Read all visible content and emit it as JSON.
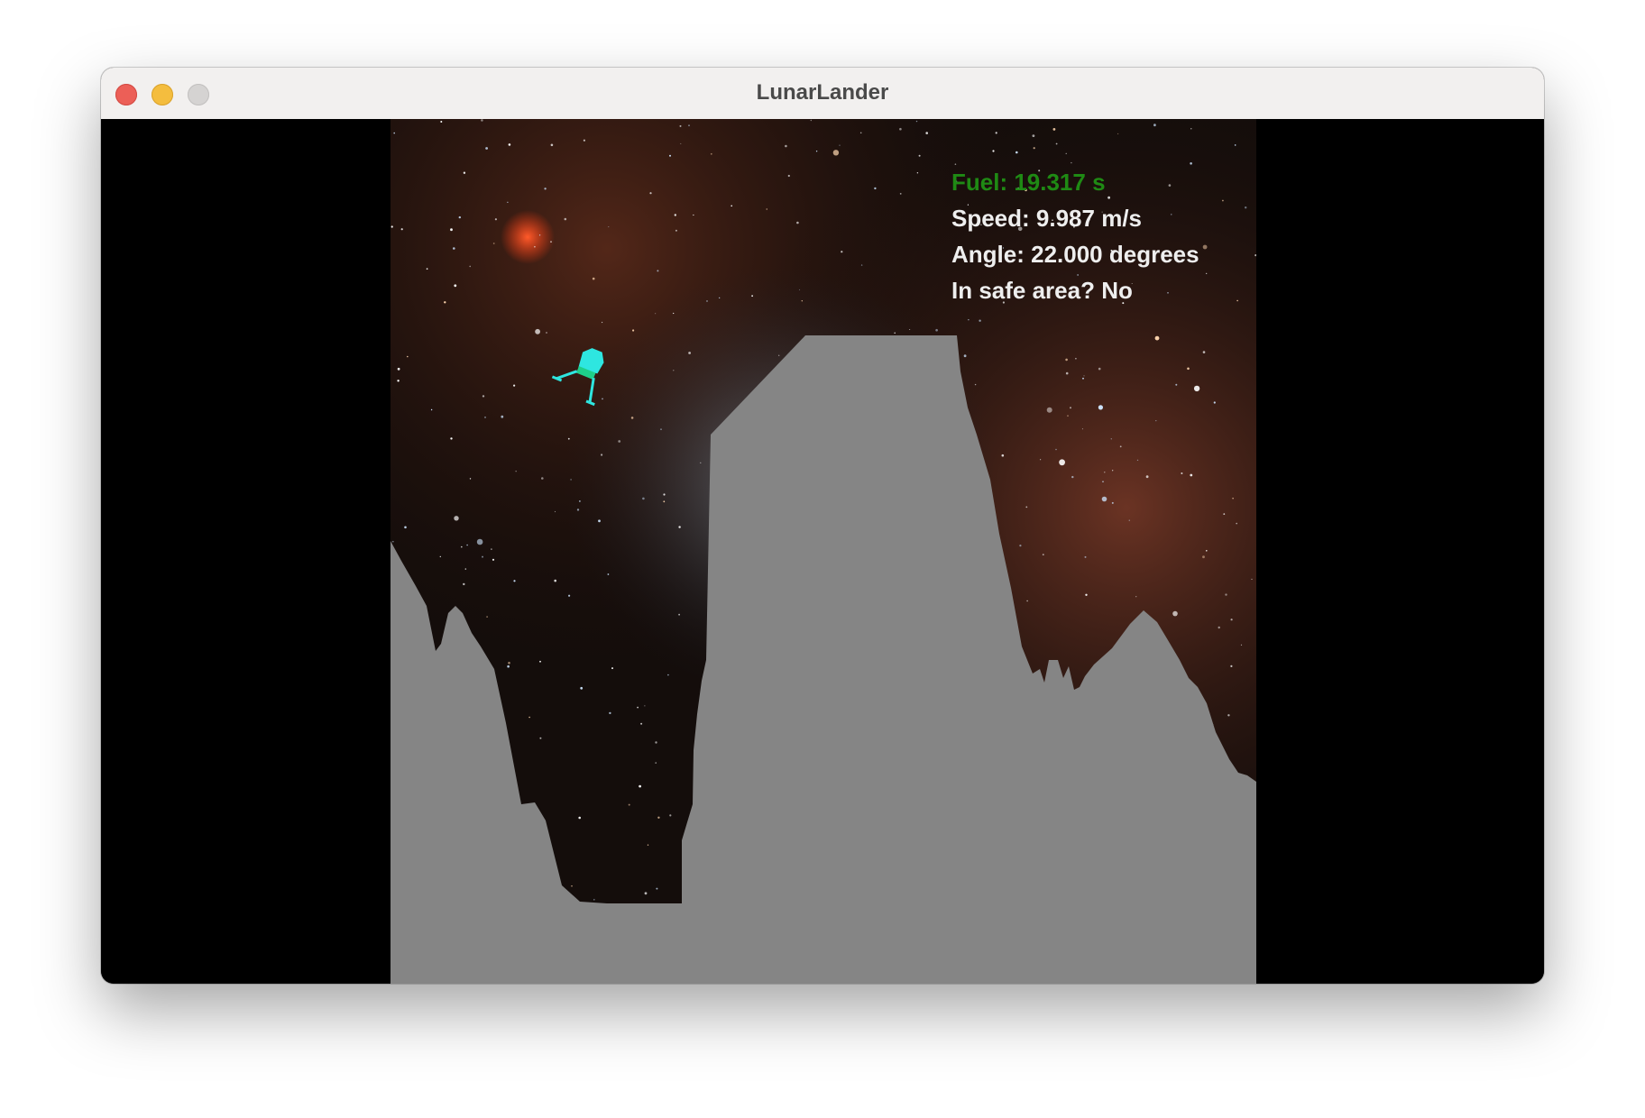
{
  "window": {
    "title": "LunarLander"
  },
  "hud": {
    "fuel": "Fuel: 19.317 s",
    "speed": "Speed: 9.987 m/s",
    "angle": "Angle: 22.000 degrees",
    "safe": "In safe area? No"
  },
  "colors": {
    "fuel_text": "#1f8a14",
    "hud_text": "#eeeeee",
    "terrain": "#858585",
    "lander": "#2ee6e0"
  }
}
